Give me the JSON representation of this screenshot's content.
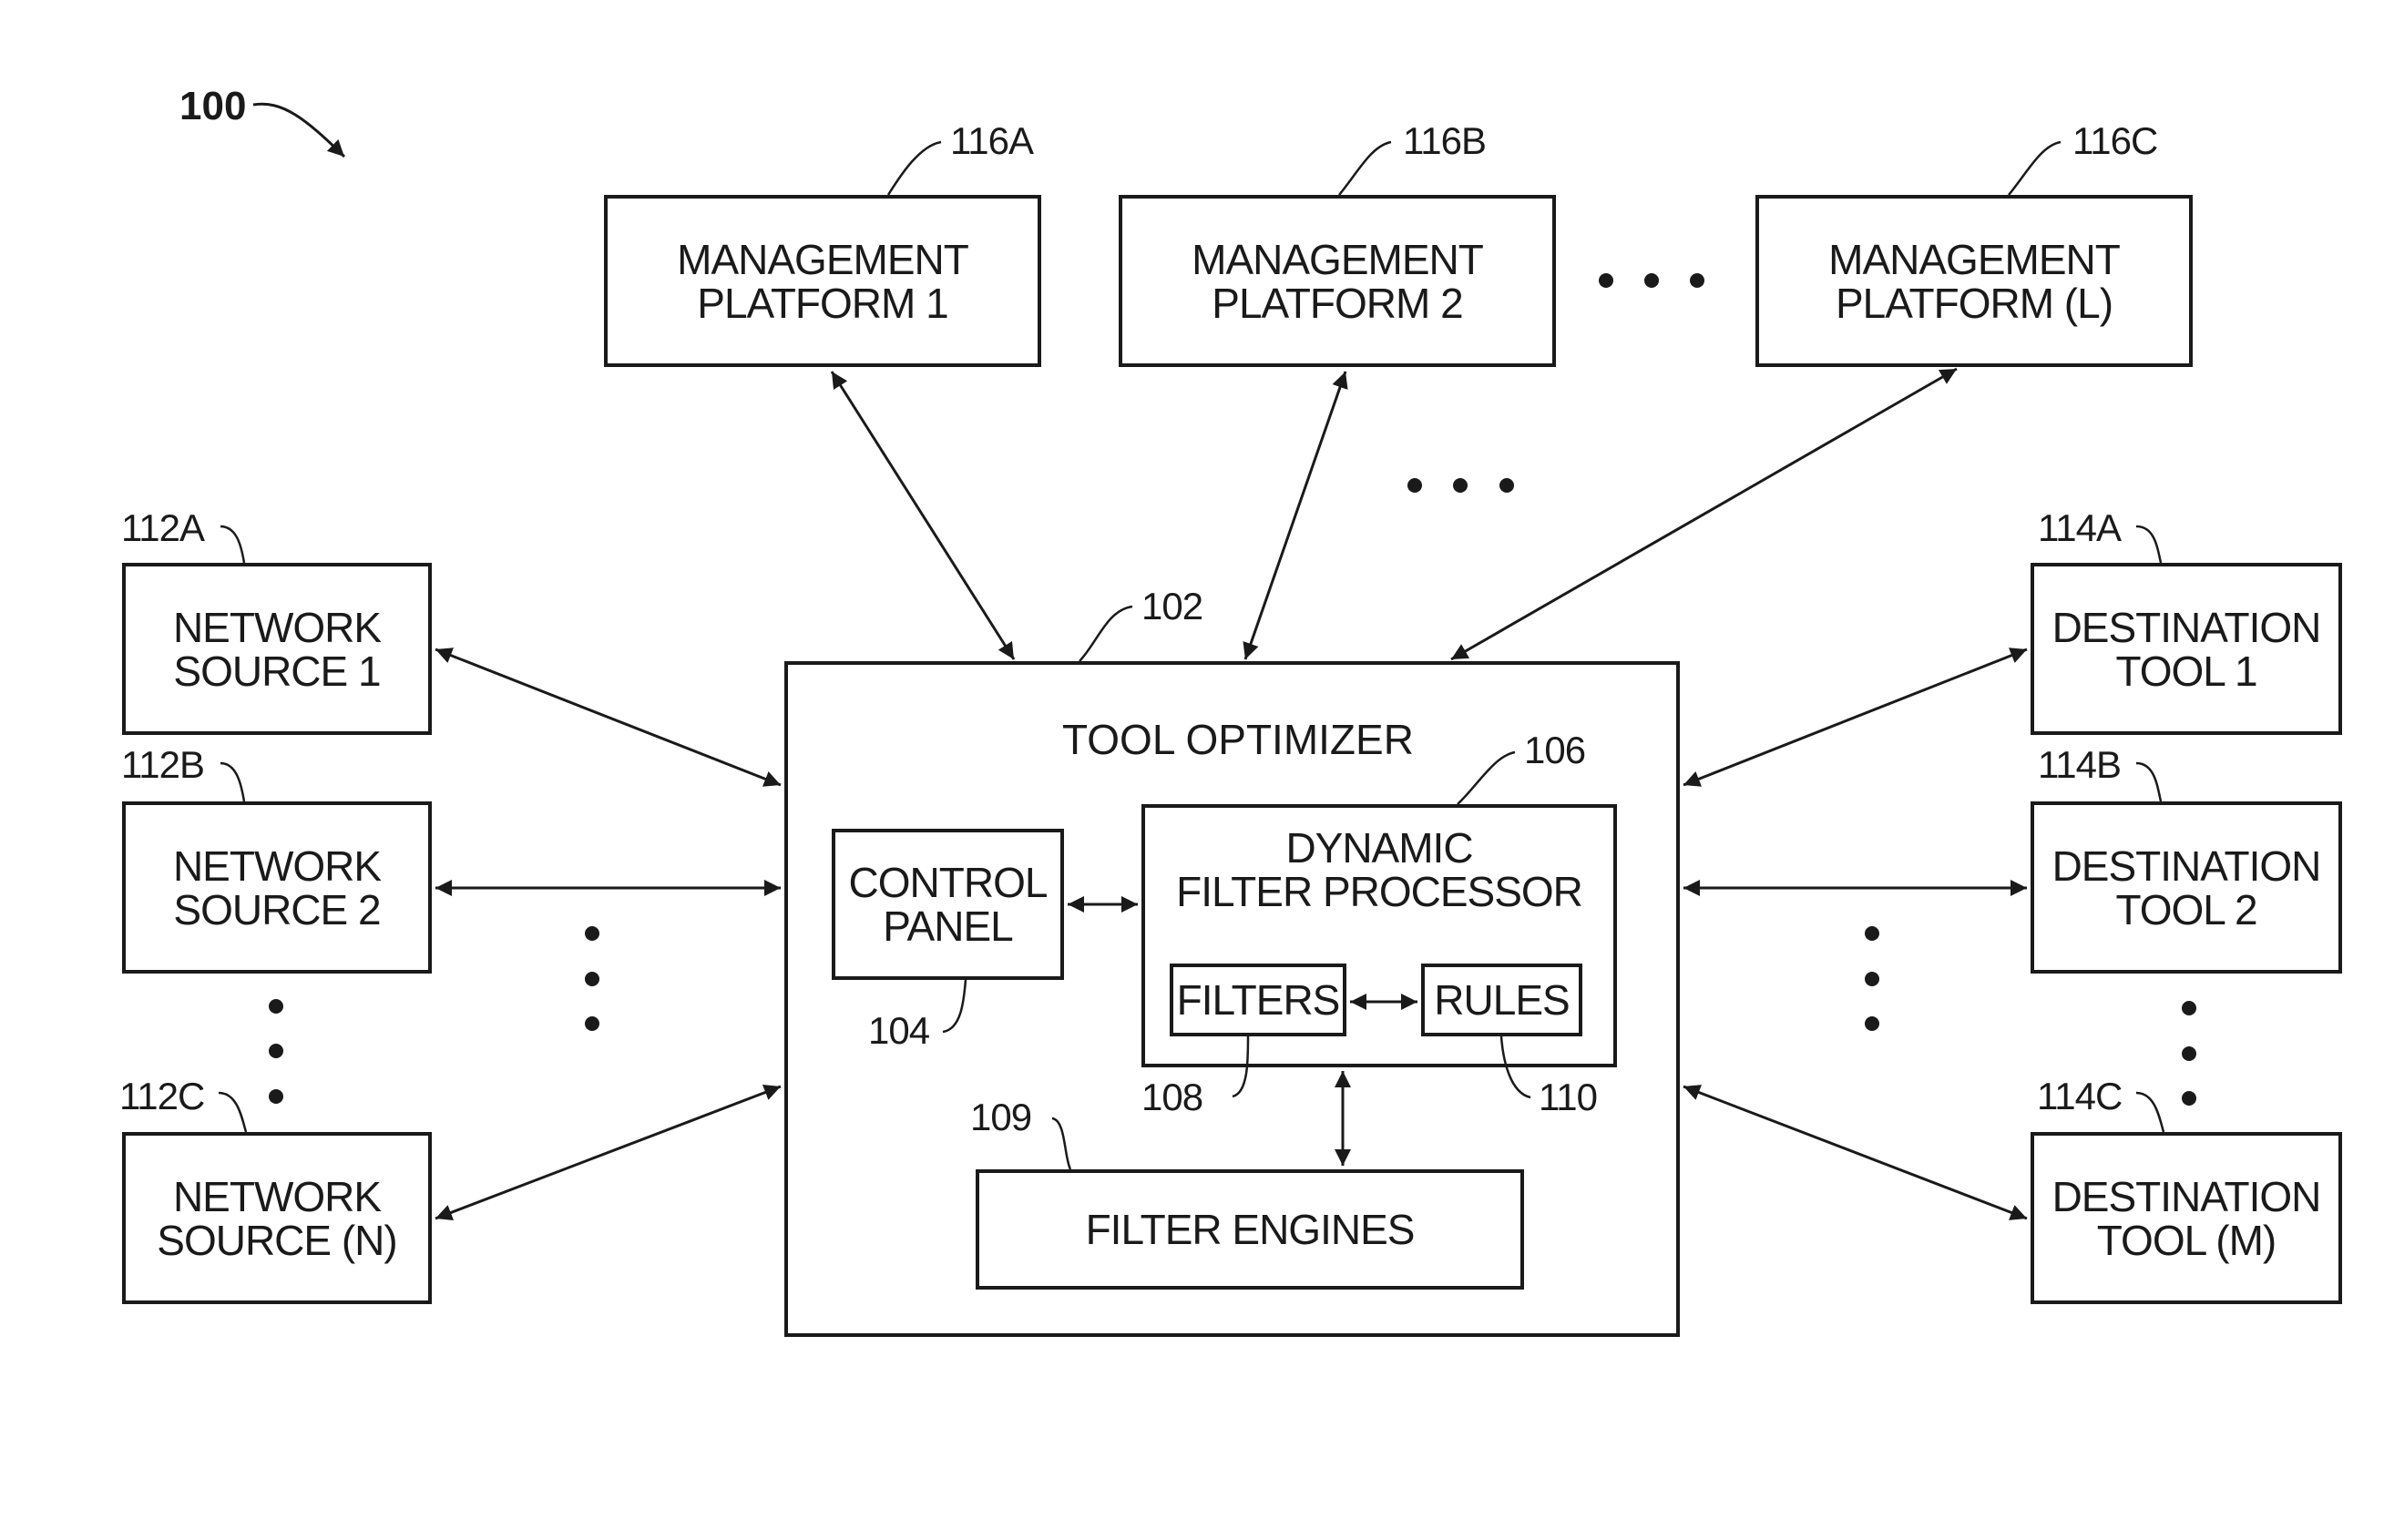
{
  "figure": {
    "number": "100"
  },
  "management_platforms": [
    {
      "ref": "116A",
      "label": "MANAGEMENT\nPLATFORM 1"
    },
    {
      "ref": "116B",
      "label": "MANAGEMENT\nPLATFORM 2"
    },
    {
      "ref": "116C",
      "label": "MANAGEMENT\nPLATFORM (L)"
    }
  ],
  "network_sources": [
    {
      "ref": "112A",
      "label": "NETWORK\nSOURCE 1"
    },
    {
      "ref": "112B",
      "label": "NETWORK\nSOURCE 2"
    },
    {
      "ref": "112C",
      "label": "NETWORK\nSOURCE (N)"
    }
  ],
  "destination_tools": [
    {
      "ref": "114A",
      "label": "DESTINATION\nTOOL 1"
    },
    {
      "ref": "114B",
      "label": "DESTINATION\nTOOL 2"
    },
    {
      "ref": "114C",
      "label": "DESTINATION\nTOOL (M)"
    }
  ],
  "tool_optimizer": {
    "ref": "102",
    "title": "TOOL OPTIMIZER",
    "control_panel": {
      "ref": "104",
      "label": "CONTROL\nPANEL"
    },
    "dynamic_filter_processor": {
      "ref": "106",
      "label": "DYNAMIC\nFILTER PROCESSOR",
      "filters": {
        "ref": "108",
        "label": "FILTERS"
      },
      "rules": {
        "ref": "110",
        "label": "RULES"
      }
    },
    "filter_engines": {
      "ref": "109",
      "label": "FILTER ENGINES"
    }
  },
  "ellipsis_glyph": "•"
}
